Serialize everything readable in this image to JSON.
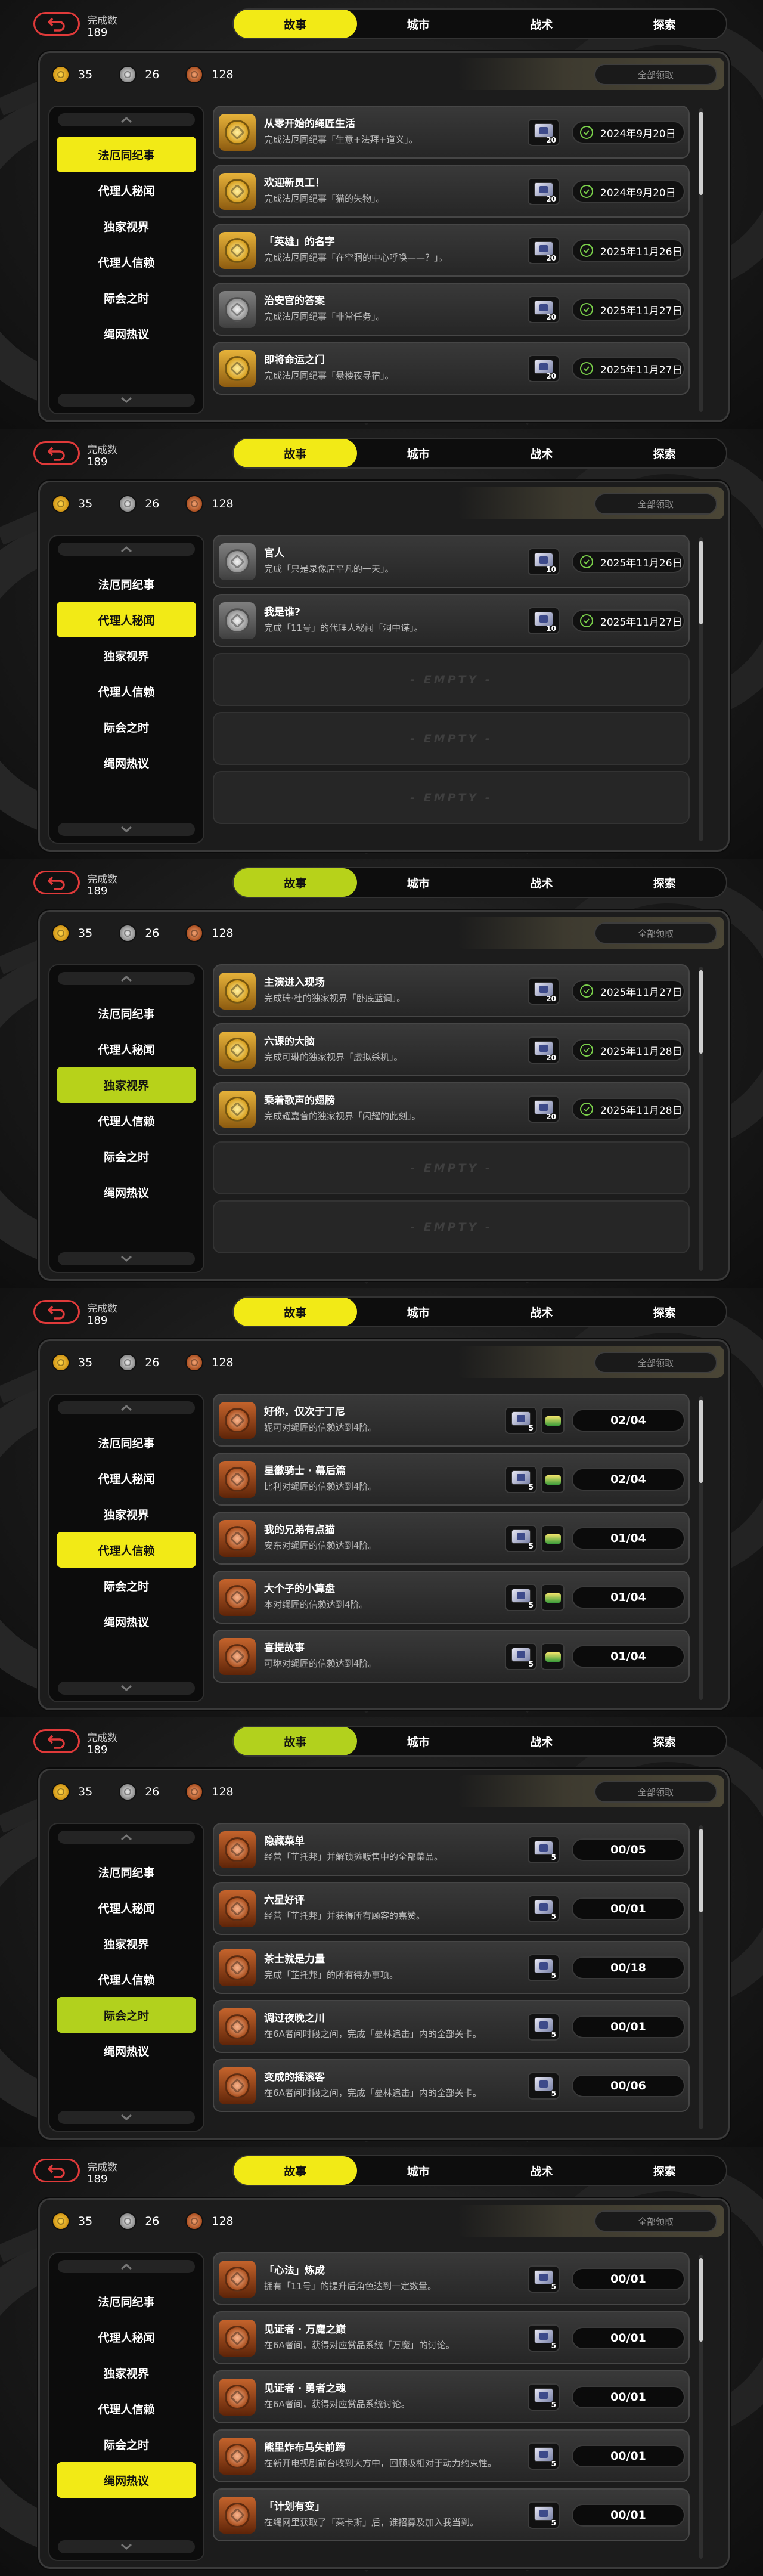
{
  "accent_colors": [
    "#f2ea16",
    "#f2ea16",
    "#b7d21a",
    "#f2ea16",
    "#b2d11d",
    "#f2ea16"
  ],
  "screens": [
    {
      "completed_label": "完成数",
      "completed_count": "189",
      "tabs": [
        "故事",
        "城市",
        "战术",
        "探索"
      ],
      "active_tab": 0,
      "resources": {
        "gold": "35",
        "silver": "26",
        "bronze": "128"
      },
      "claim_all": "全部领取",
      "sidebar": [
        "法厄同纪事",
        "代理人秘闻",
        "独家视界",
        "代理人信赖",
        "际会之时",
        "绳网热议"
      ],
      "active_side": 0,
      "rows": [
        {
          "kind": "gold",
          "title": "从零开始的绳匠生活",
          "desc": "完成法厄同纪事「生意+法拜+道义」。",
          "reward_qty": "20",
          "date": "2024年9月20日"
        },
        {
          "kind": "gold",
          "title": "欢迎新员工！",
          "desc": "完成法厄同纪事「猫的失物」。",
          "reward_qty": "20",
          "date": "2024年9月20日"
        },
        {
          "kind": "gold",
          "title": "「英雄」的名字",
          "desc": "完成法厄同纪事「在空洞的中心呼唤——？」。",
          "reward_qty": "20",
          "date": "2025年11月26日"
        },
        {
          "kind": "grey",
          "title": "治安官的答案",
          "desc": "完成法厄同纪事「非常任务」。",
          "reward_qty": "20",
          "date": "2025年11月27日"
        },
        {
          "kind": "gold",
          "title": "即将命运之门",
          "desc": "完成法厄同纪事「悬楼夜寻宿」。",
          "reward_qty": "20",
          "date": "2025年11月27日"
        }
      ]
    },
    {
      "completed_label": "完成数",
      "completed_count": "189",
      "tabs": [
        "故事",
        "城市",
        "战术",
        "探索"
      ],
      "active_tab": 0,
      "resources": {
        "gold": "35",
        "silver": "26",
        "bronze": "128"
      },
      "claim_all": "全部领取",
      "sidebar": [
        "法厄同纪事",
        "代理人秘闻",
        "独家视界",
        "代理人信赖",
        "际会之时",
        "绳网热议"
      ],
      "active_side": 1,
      "rows": [
        {
          "kind": "grey",
          "title": "官人",
          "desc": "完成「只是录像店平凡的一天」。",
          "reward_qty": "10",
          "date": "2025年11月26日"
        },
        {
          "kind": "grey",
          "title": "我是谁?",
          "desc": "完成「11号」的代理人秘闻「洞中谋」。",
          "reward_qty": "10",
          "date": "2025年11月27日"
        },
        {
          "empty": "- EMPTY -"
        },
        {
          "empty": "- EMPTY -"
        },
        {
          "empty": "- EMPTY -"
        }
      ]
    },
    {
      "completed_label": "完成数",
      "completed_count": "189",
      "tabs": [
        "故事",
        "城市",
        "战术",
        "探索"
      ],
      "active_tab": 0,
      "resources": {
        "gold": "35",
        "silver": "26",
        "bronze": "128"
      },
      "claim_all": "全部领取",
      "sidebar": [
        "法厄同纪事",
        "代理人秘闻",
        "独家视界",
        "代理人信赖",
        "际会之时",
        "绳网热议"
      ],
      "active_side": 2,
      "rows": [
        {
          "kind": "gold",
          "title": "主演进入现场",
          "desc": "完成瑞·杜的独家视界「卧底蓝调」。",
          "reward_qty": "20",
          "date": "2025年11月27日"
        },
        {
          "kind": "gold",
          "title": "六课的大脑",
          "desc": "完成可琳的独家视界「虚拟杀机」。",
          "reward_qty": "20",
          "date": "2025年11月28日"
        },
        {
          "kind": "gold",
          "title": "乘着歌声的翅膀",
          "desc": "完成耀嘉音的独家视界「闪耀的此刻」。",
          "reward_qty": "20",
          "date": "2025年11月28日"
        },
        {
          "empty": "- EMPTY -"
        },
        {
          "empty": "- EMPTY -"
        }
      ]
    },
    {
      "completed_label": "完成数",
      "completed_count": "189",
      "tabs": [
        "故事",
        "城市",
        "战术",
        "探索"
      ],
      "active_tab": 0,
      "resources": {
        "gold": "35",
        "silver": "26",
        "bronze": "128"
      },
      "claim_all": "全部领取",
      "sidebar": [
        "法厄同纪事",
        "代理人秘闻",
        "独家视界",
        "代理人信赖",
        "际会之时",
        "绳网热议"
      ],
      "active_side": 3,
      "rows": [
        {
          "kind": "copper",
          "title": "好你，仅次于丁尼",
          "desc": "妮可对绳匠的信赖达到4阶。",
          "reward_qty": "5",
          "has_chip": true,
          "progress": "02/04"
        },
        {
          "kind": "copper",
          "title": "星徽骑士 · 幕后篇",
          "desc": "比利对绳匠的信赖达到4阶。",
          "reward_qty": "5",
          "has_chip": true,
          "progress": "02/04"
        },
        {
          "kind": "copper",
          "title": "我的兄弟有点猫",
          "desc": "安东对绳匠的信赖达到4阶。",
          "reward_qty": "5",
          "has_chip": true,
          "progress": "01/04"
        },
        {
          "kind": "copper",
          "title": "大个子的小算盘",
          "desc": "本对绳匠的信赖达到4阶。",
          "reward_qty": "5",
          "has_chip": true,
          "progress": "01/04"
        },
        {
          "kind": "copper",
          "title": "喜提故事",
          "desc": "可琳对绳匠的信赖达到4阶。",
          "reward_qty": "5",
          "has_chip": true,
          "progress": "01/04"
        }
      ]
    },
    {
      "completed_label": "完成数",
      "completed_count": "189",
      "tabs": [
        "故事",
        "城市",
        "战术",
        "探索"
      ],
      "active_tab": 0,
      "resources": {
        "gold": "35",
        "silver": "26",
        "bronze": "128"
      },
      "claim_all": "全部领取",
      "sidebar": [
        "法厄同纪事",
        "代理人秘闻",
        "独家视界",
        "代理人信赖",
        "际会之时",
        "绳网热议"
      ],
      "active_side": 4,
      "rows": [
        {
          "kind": "copper",
          "title": "隐藏菜单",
          "desc": "经营「芷托邦」并解锁摊贩售中的全部菜品。",
          "reward_qty": "5",
          "progress": "00/05"
        },
        {
          "kind": "copper",
          "title": "六星好评",
          "desc": "经营「芷托邦」并获得所有顾客的嘉赞。",
          "reward_qty": "5",
          "progress": "00/01"
        },
        {
          "kind": "copper",
          "title": "茶士就是力量",
          "desc": "完成「芷托邦」的所有待办事项。",
          "reward_qty": "5",
          "progress": "00/18"
        },
        {
          "kind": "copper",
          "title": "调过夜晚之川",
          "desc": "在6A者间时段之间，完成「蔓林追击」内的全部关卡。",
          "reward_qty": "5",
          "progress": "00/01"
        },
        {
          "kind": "copper",
          "title": "变成的摇滚客",
          "desc": "在6A者间时段之间，完成「蔓林追击」内的全部关卡。",
          "reward_qty": "5",
          "progress": "00/06"
        }
      ]
    },
    {
      "completed_label": "完成数",
      "completed_count": "189",
      "tabs": [
        "故事",
        "城市",
        "战术",
        "探索"
      ],
      "active_tab": 0,
      "resources": {
        "gold": "35",
        "silver": "26",
        "bronze": "128"
      },
      "claim_all": "全部领取",
      "sidebar": [
        "法厄同纪事",
        "代理人秘闻",
        "独家视界",
        "代理人信赖",
        "际会之时",
        "绳网热议"
      ],
      "active_side": 5,
      "rows": [
        {
          "kind": "copper",
          "title": "「心法」炼成",
          "desc": "拥有「11号」的提升后角色达到一定数量。",
          "reward_qty": "5",
          "progress": "00/01"
        },
        {
          "kind": "copper",
          "title": "见证者 · 万魔之巅",
          "desc": "在6A者间，获得对应赏品系统「万魔」的讨论。",
          "reward_qty": "5",
          "progress": "00/01"
        },
        {
          "kind": "copper",
          "title": "见证者 · 勇者之魂",
          "desc": "在6A者间，获得对应赏品系统讨论。",
          "reward_qty": "5",
          "progress": "00/01"
        },
        {
          "kind": "copper",
          "title": "熊里炸布马失前蹄",
          "desc": "在新开电视剧前台收到大方中，回顾吸相对于动力约束性。",
          "reward_qty": "5",
          "progress": "00/01"
        },
        {
          "kind": "copper",
          "title": "「计划有变」",
          "desc": "在绳网里获取了「莱卡斯」后，谁招募及加入我当到。",
          "reward_qty": "5",
          "progress": "00/01"
        }
      ]
    }
  ]
}
